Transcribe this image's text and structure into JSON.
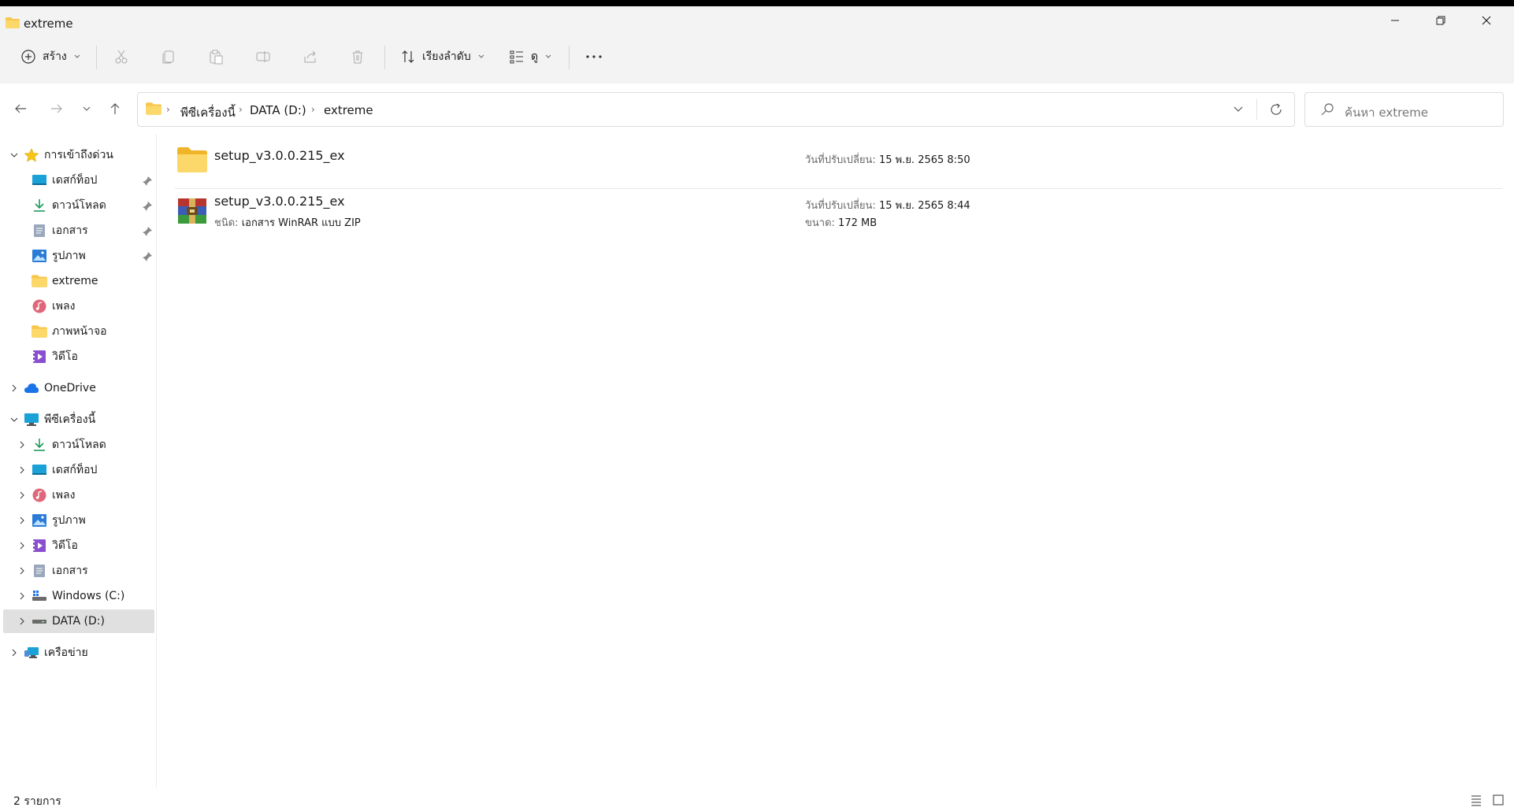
{
  "window": {
    "title": "extreme"
  },
  "toolbar": {
    "new_label": "สร้าง",
    "sort_label": "เรียงลำดับ",
    "view_label": "ดู"
  },
  "address": {
    "crumbs": [
      "พีซีเครื่องนี้",
      "DATA (D:)",
      "extreme"
    ],
    "search_placeholder": "ค้นหา extreme"
  },
  "sidebar": {
    "quick_access": {
      "label": "การเข้าถึงด่วน",
      "items": [
        "เดสก์ท็อป",
        "ดาวน์โหลด",
        "เอกสาร",
        "รูปภาพ",
        "extreme",
        "เพลง",
        "ภาพหน้าจอ",
        "วิดีโอ"
      ]
    },
    "onedrive": {
      "label": "OneDrive"
    },
    "this_pc": {
      "label": "พีซีเครื่องนี้",
      "items": [
        "ดาวน์โหลด",
        "เดสก์ท็อป",
        "เพลง",
        "รูปภาพ",
        "วิดีโอ",
        "เอกสาร",
        "Windows (C:)",
        "DATA (D:)"
      ]
    },
    "network": {
      "label": "เครือข่าย"
    }
  },
  "files": [
    {
      "name": "setup_v3.0.0.215_ex",
      "modified_label": "วันที่ปรับเปลี่ยน:",
      "modified": "15 พ.ย. 2565 8:50"
    },
    {
      "name": "setup_v3.0.0.215_ex",
      "type_label": "ชนิด:",
      "type": "เอกสาร WinRAR แบบ ZIP",
      "modified_label": "วันที่ปรับเปลี่ยน:",
      "modified": "15 พ.ย. 2565 8:44",
      "size_label": "ขนาด:",
      "size": "172 MB"
    }
  ],
  "status": {
    "count": "2 รายการ"
  },
  "colors": {
    "folder": "#f8c64a",
    "accent": "#1a73e8",
    "selected": "#e0e0e0"
  },
  "icons": {
    "desktop": "desktop-icon",
    "downloads": "download-icon",
    "documents": "document-icon",
    "pictures": "picture-icon",
    "music": "music-icon",
    "videos": "video-icon",
    "folder": "folder-icon",
    "onedrive": "cloud-icon",
    "pc": "monitor-icon",
    "drive": "drive-icon",
    "network": "network-icon"
  }
}
